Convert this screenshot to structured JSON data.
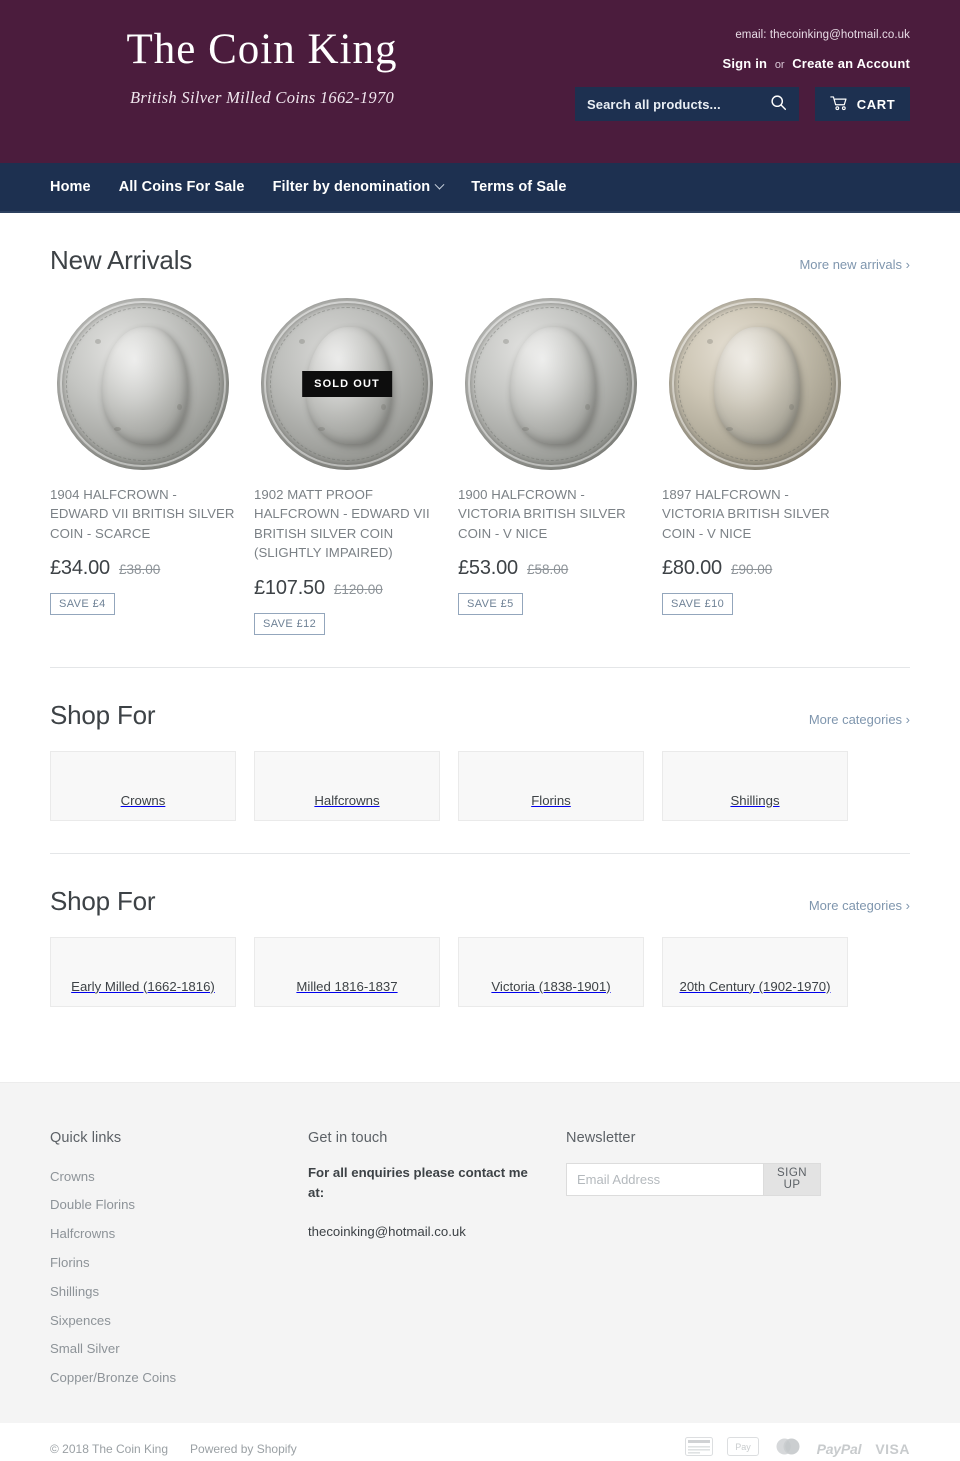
{
  "header": {
    "logo_title": "The Coin King",
    "logo_tagline": "British Silver Milled Coins 1662-1970",
    "email_line": "email: thecoinking@hotmail.co.uk",
    "sign_in": "Sign in",
    "or": "or",
    "create_account": "Create an Account",
    "search_placeholder": "Search all products...",
    "search_value": "",
    "cart_label": "CART",
    "bg_color": "#4b1c3d",
    "accent_color": "#1d3050"
  },
  "nav": {
    "items": [
      {
        "label": "Home",
        "has_dropdown": false
      },
      {
        "label": "All Coins For Sale",
        "has_dropdown": false
      },
      {
        "label": "Filter by denomination",
        "has_dropdown": true
      },
      {
        "label": "Terms of Sale",
        "has_dropdown": false
      }
    ]
  },
  "new_arrivals": {
    "title": "New Arrivals",
    "more_label": "More new arrivals ›",
    "products": [
      {
        "title": "1904 HALFCROWN - EDWARD VII BRITISH SILVER COIN - SCARCE",
        "price": "£34.00",
        "compare_price": "£38.00",
        "save_label": "SAVE £4",
        "sold_out": false,
        "sold_out_label": ""
      },
      {
        "title": "1902 MATT PROOF HALFCROWN - EDWARD VII BRITISH SILVER COIN (SLIGHTLY IMPAIRED)",
        "price": "£107.50",
        "compare_price": "£120.00",
        "save_label": "SAVE £12",
        "sold_out": true,
        "sold_out_label": "SOLD OUT"
      },
      {
        "title": "1900 HALFCROWN - VICTORIA BRITISH SILVER COIN - V NICE",
        "price": "£53.00",
        "compare_price": "£58.00",
        "save_label": "SAVE £5",
        "sold_out": false,
        "sold_out_label": ""
      },
      {
        "title": "1897 HALFCROWN - VICTORIA BRITISH SILVER COIN - V NICE",
        "price": "£80.00",
        "compare_price": "£90.00",
        "save_label": "SAVE £10",
        "sold_out": false,
        "sold_out_label": ""
      }
    ]
  },
  "shop_for_denominations": {
    "title": "Shop For",
    "more_label": "More categories ›",
    "categories": [
      {
        "label": "Crowns"
      },
      {
        "label": "Halfcrowns"
      },
      {
        "label": "Florins"
      },
      {
        "label": "Shillings"
      }
    ]
  },
  "shop_for_periods": {
    "title": "Shop For",
    "more_label": "More categories ›",
    "categories": [
      {
        "label": "Early Milled (1662-1816)"
      },
      {
        "label": "Milled 1816-1837"
      },
      {
        "label": "Victoria (1838-1901)"
      },
      {
        "label": "20th Century (1902-1970)"
      }
    ]
  },
  "footer": {
    "quick_links_title": "Quick links",
    "quick_links": [
      {
        "label": "Crowns"
      },
      {
        "label": "Double Florins"
      },
      {
        "label": "Halfcrowns"
      },
      {
        "label": "Florins"
      },
      {
        "label": "Shillings"
      },
      {
        "label": "Sixpences"
      },
      {
        "label": "Small Silver"
      },
      {
        "label": "Copper/Bronze Coins"
      }
    ],
    "contact_title": "Get in touch",
    "contact_text": "For all enquiries please contact me at:",
    "contact_email": "thecoinking@hotmail.co.uk",
    "newsletter_title": "Newsletter",
    "newsletter_placeholder": "Email Address",
    "newsletter_value": "",
    "signup_label": "SIGN UP",
    "copyright": "© 2018 The Coin King",
    "powered_by": "Powered by Shopify",
    "payment_icons": [
      {
        "name": "generic-card-icon",
        "label": ""
      },
      {
        "name": "apple-pay-icon",
        "label": "Pay"
      },
      {
        "name": "mastercard-icon",
        "label": ""
      },
      {
        "name": "paypal-icon",
        "label": "PayPal"
      },
      {
        "name": "visa-icon",
        "label": "VISA"
      }
    ]
  }
}
